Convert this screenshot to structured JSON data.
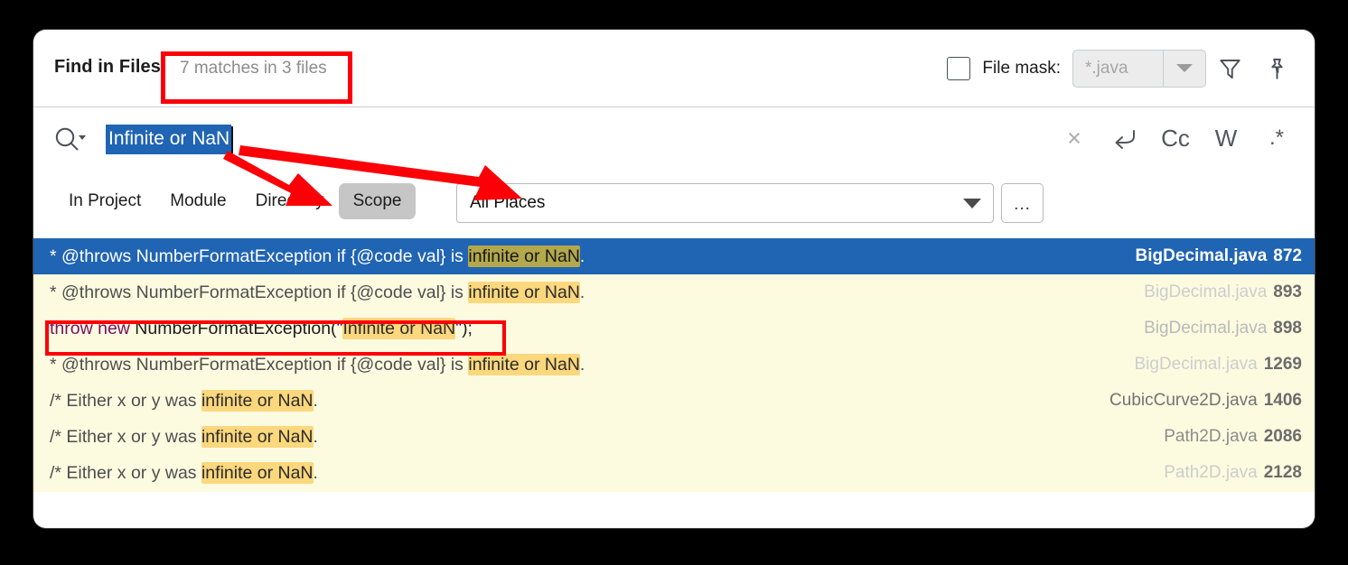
{
  "window": {
    "title": "Find in Files",
    "match_summary": "7 matches in 3 files"
  },
  "header": {
    "file_mask_label": "File mask:",
    "file_mask_value": "*.java",
    "file_mask_checked": false,
    "filter_icon": "filter-icon",
    "pin_icon": "pin-icon"
  },
  "search": {
    "query": "Infinite or NaN",
    "selected": true,
    "magnifier_icon": "search-icon",
    "buttons": [
      {
        "name": "clear-search-button",
        "label": "×"
      },
      {
        "name": "new-line-button",
        "label": "↩"
      },
      {
        "name": "match-case-button",
        "label": "Cc"
      },
      {
        "name": "words-button",
        "label": "W"
      },
      {
        "name": "regex-button",
        "label": ".*"
      }
    ]
  },
  "scope": {
    "tabs": [
      {
        "label": "In Project",
        "selected": false
      },
      {
        "label": "Module",
        "selected": false
      },
      {
        "label": "Directory",
        "selected": false
      },
      {
        "label": "Scope",
        "selected": true
      }
    ],
    "places_value": "All Places",
    "more_button": "..."
  },
  "results": {
    "rows": [
      {
        "selected": true,
        "prefix": "* @throws NumberFormatException if {@code val} is ",
        "match": "infinite or NaN",
        "suffix": ".",
        "file": "BigDecimal.java",
        "line": "872",
        "fade": 0
      },
      {
        "selected": false,
        "prefix": "* @throws NumberFormatException if {@code val} is ",
        "match": "infinite or NaN",
        "suffix": ".",
        "file": "BigDecimal.java",
        "line": "893",
        "fade": 1
      },
      {
        "selected": false,
        "code": true,
        "kw1": "throw new",
        "code_mid": " NumberFormatException(",
        "quote_open": "\"",
        "match": "Infinite or NaN",
        "quote_close": "\"",
        "code_end": ");",
        "file": "BigDecimal.java",
        "line": "898",
        "fade": 2
      },
      {
        "selected": false,
        "prefix": "* @throws NumberFormatException if {@code val} is ",
        "match": "infinite or NaN",
        "suffix": ".",
        "file": "BigDecimal.java",
        "line": "1269",
        "fade": 1
      },
      {
        "selected": false,
        "prefix": "/* Either x or y was ",
        "match": "infinite or NaN",
        "suffix": ".",
        "file": "CubicCurve2D.java",
        "line": "1406",
        "fade": 4
      },
      {
        "selected": false,
        "prefix": "/* Either x or y was ",
        "match": "infinite or NaN",
        "suffix": ".",
        "file": "Path2D.java",
        "line": "2086",
        "fade": 3
      },
      {
        "selected": false,
        "prefix": "/* Either x or y was ",
        "match": "infinite or NaN",
        "suffix": ".",
        "file": "Path2D.java",
        "line": "2128",
        "fade": 1
      }
    ]
  },
  "annotations": {
    "color": "#fb0007",
    "boxes": [
      "match-summary-highlight",
      "code-result-row-highlight"
    ],
    "arrows": [
      "arrow-to-scope-tab",
      "arrow-to-all-places-dropdown"
    ]
  }
}
